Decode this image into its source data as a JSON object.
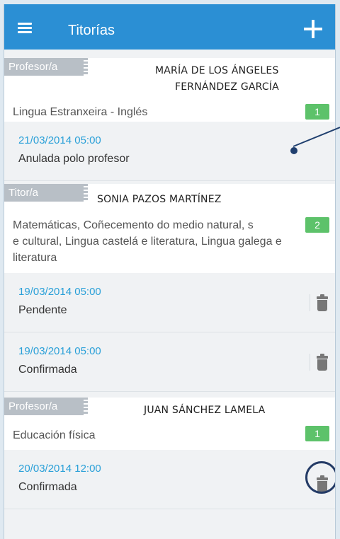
{
  "appbar": {
    "title": "Titorías",
    "menu_icon": "hamburger-menu-icon",
    "add_icon": "plus-icon"
  },
  "groups": [
    {
      "role": "Profesor/a",
      "name_line1": "MARÍA DE LOS ÁNGELES",
      "name_line2": "FERNÁNDEZ GARCÍA",
      "subject": "Lingua Estranxeira - Inglés",
      "count": "1",
      "appointments": [
        {
          "date": "21/03/2014 05:00",
          "status": "Anulada polo profesor"
        }
      ]
    },
    {
      "role": "Titor/a",
      "name_line1": "SONIA PAZOS MARTÍNEZ",
      "subject_lines": [
        "Matemáticas, Coñecemento do medio natural, s",
        "e cultural, Lingua castelá e literatura, Lingua galega e",
        "literatura"
      ],
      "count": "2",
      "appointments": [
        {
          "date": "19/03/2014 05:00",
          "status": "Pendente"
        },
        {
          "date": "19/03/2014 05:00",
          "status": "Confirmada"
        }
      ]
    },
    {
      "role": "Profesor/a",
      "name_line1": "JUAN SÁNCHEZ LAMELA",
      "subject": "Educación física",
      "count": "1",
      "appointments": [
        {
          "date": "20/03/2014 12:00",
          "status": "Confirmada"
        }
      ]
    }
  ],
  "colors": {
    "appbar": "#2b8fd4",
    "badge": "#5dc26a",
    "date": "#2aa0d8",
    "tag": "#b8bfc6"
  }
}
